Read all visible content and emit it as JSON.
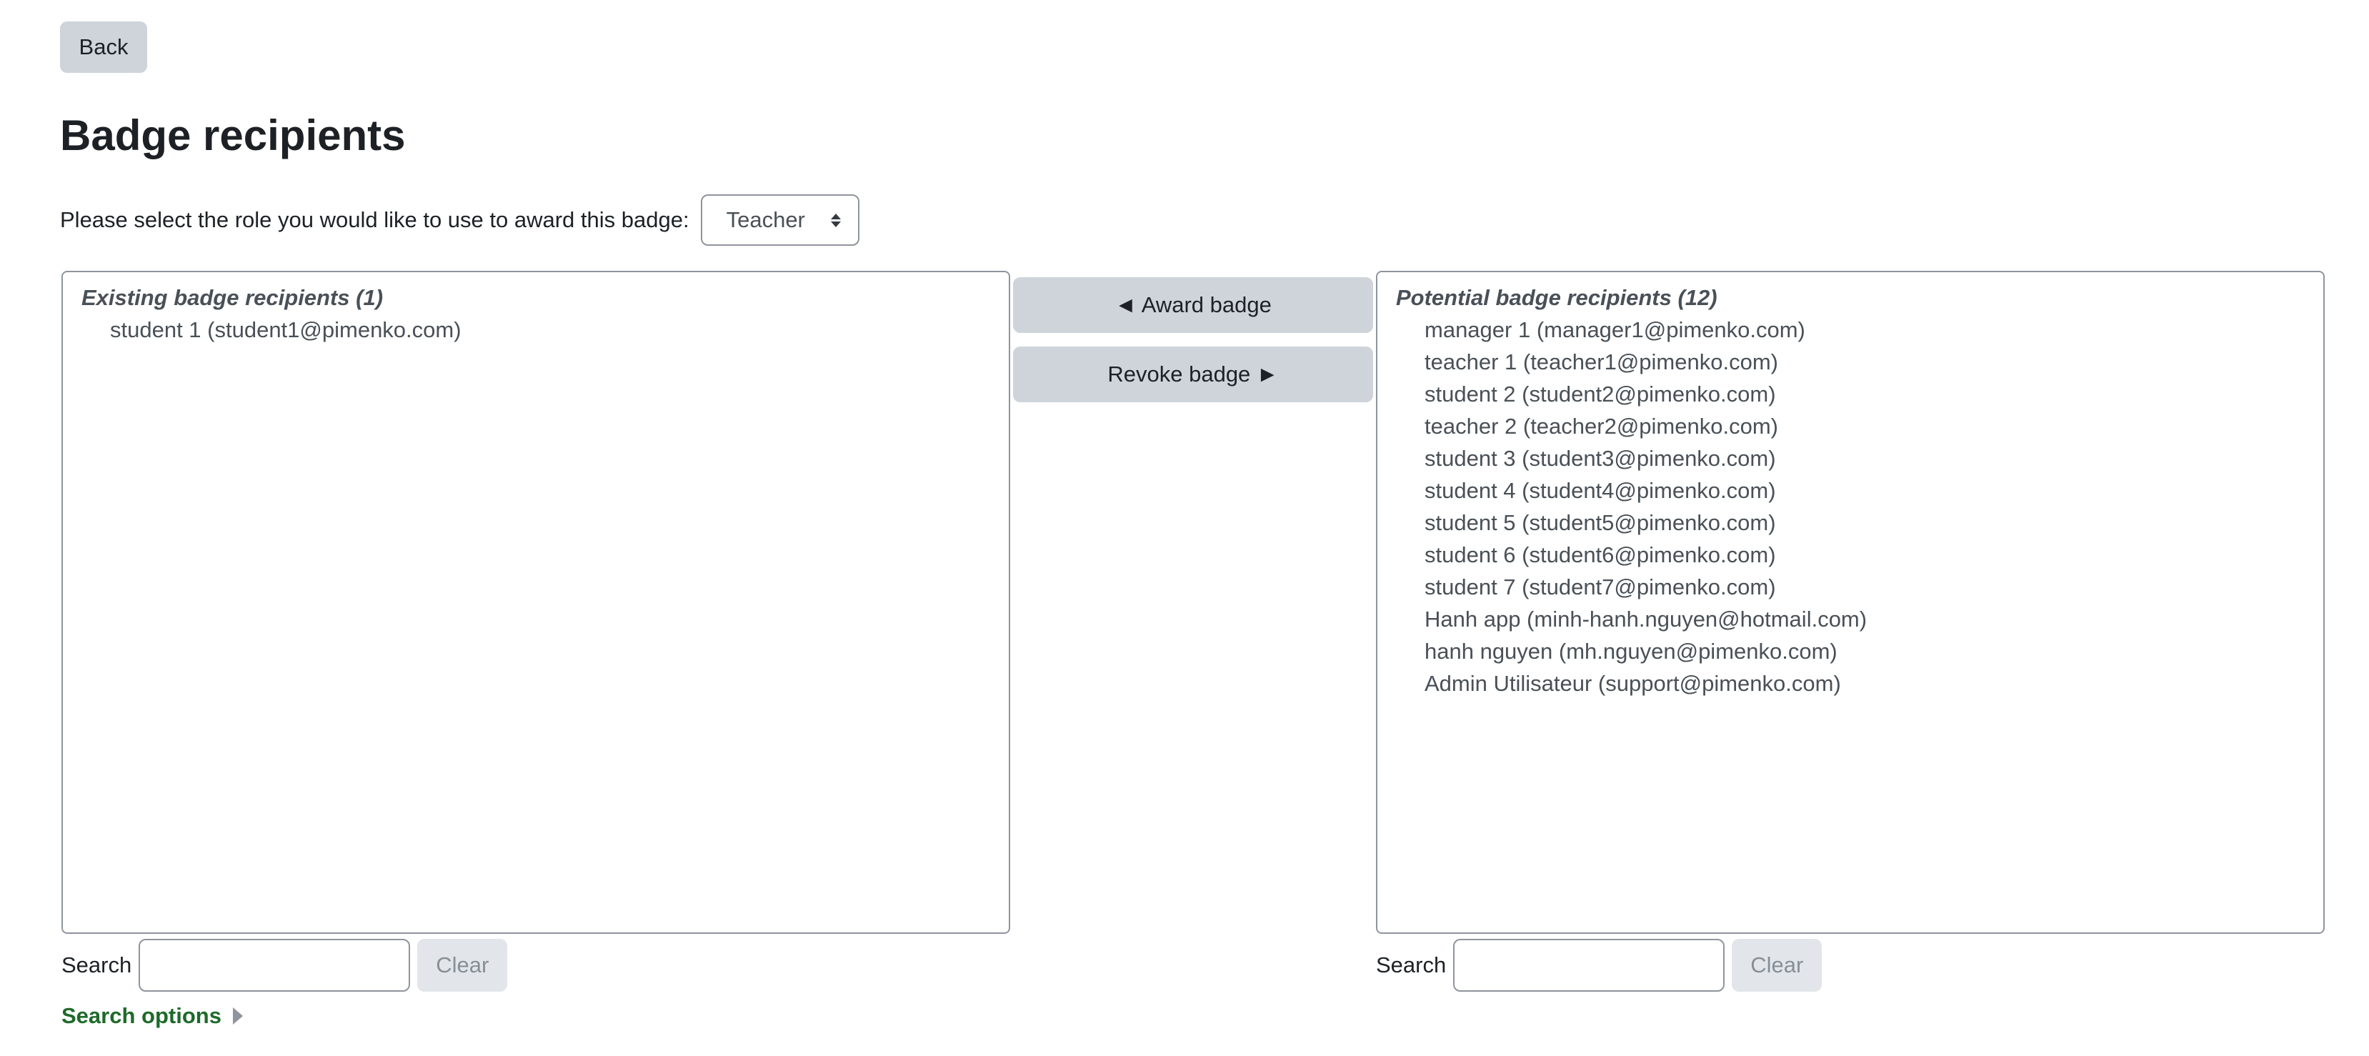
{
  "back_button": {
    "label": "Back"
  },
  "page_title": "Badge recipients",
  "role_selector": {
    "label": "Please select the role you would like to use to award this badge:",
    "selected": "Teacher"
  },
  "existing": {
    "group_label": "Existing badge recipients (1)",
    "options": [
      "student 1 (student1@pimenko.com)"
    ]
  },
  "actions": {
    "award_label": "◄ Award badge",
    "revoke_label": "Revoke badge ►"
  },
  "potential": {
    "group_label": "Potential badge recipients (12)",
    "options": [
      "manager 1 (manager1@pimenko.com)",
      "teacher 1 (teacher1@pimenko.com)",
      "student 2 (student2@pimenko.com)",
      "teacher 2 (teacher2@pimenko.com)",
      "student 3 (student3@pimenko.com)",
      "student 4 (student4@pimenko.com)",
      "student 5 (student5@pimenko.com)",
      "student 6 (student6@pimenko.com)",
      "student 7 (student7@pimenko.com)",
      "Hanh app (minh-hanh.nguyen@hotmail.com)",
      "hanh nguyen (mh.nguyen@pimenko.com)",
      "Admin Utilisateur (support@pimenko.com)"
    ]
  },
  "search_left": {
    "label": "Search",
    "value": "",
    "clear_label": "Clear"
  },
  "search_right": {
    "label": "Search",
    "value": "",
    "clear_label": "Clear"
  },
  "search_options": {
    "label": "Search options"
  },
  "colors": {
    "button_bg": "#ced4da",
    "link_green": "#1e6a2a",
    "border": "#8f959e",
    "text": "#1d2125"
  }
}
